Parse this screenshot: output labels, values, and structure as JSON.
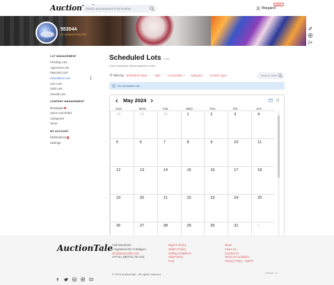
{
  "header": {
    "logo": "AuctionTale",
    "search_placeholder": "Search any keyword or lot number",
    "user_name": "Margaret",
    "user_badge": "admin"
  },
  "profile": {
    "username": "553044",
    "role": "ADMINISTRATOR"
  },
  "sidebar": {
    "sections": [
      {
        "heading": "LOT MANAGEMENT",
        "items": [
          {
            "label": "Pending Lots"
          },
          {
            "label": "Approved Lots"
          },
          {
            "label": "Rejected Lots"
          },
          {
            "label": "Scheduled Lots",
            "active": true
          },
          {
            "label": "Live Lots"
          },
          {
            "label": "Sold Lots"
          },
          {
            "label": "Unsold Lots"
          }
        ]
      },
      {
        "heading": "CONTENT MANAGEMENT",
        "items": [
          {
            "label": "Messages",
            "badge": true
          },
          {
            "label": "Users And Roles"
          },
          {
            "label": "Categories"
          },
          {
            "label": "News"
          }
        ]
      },
      {
        "heading": "MY ACCOUNT",
        "items": [
          {
            "label": "Notifications",
            "badge": true
          },
          {
            "label": "Settings"
          }
        ]
      }
    ]
  },
  "main": {
    "title": "Scheduled Lots",
    "count": "0 lots",
    "subtitle": "Lots scheduled, either planned or live",
    "filter_label": "Filter by:",
    "filters": [
      "Estimated Value",
      "Sale",
      "Lot Number",
      "Category",
      "Auction Type"
    ],
    "search_placeholder": "Search Table",
    "notice": "No scheduled lots"
  },
  "calendar": {
    "month_label": "May 2024",
    "weekdays": [
      "SUN",
      "MON",
      "TUE",
      "WED",
      "THU",
      "FRI",
      "SAT"
    ],
    "weeks": [
      [
        {
          "d": "28",
          "m": true
        },
        {
          "d": "29",
          "m": true
        },
        {
          "d": "30",
          "m": true
        },
        {
          "d": "1"
        },
        {
          "d": "2"
        },
        {
          "d": "3"
        },
        {
          "d": "4"
        }
      ],
      [
        {
          "d": "5"
        },
        {
          "d": "6"
        },
        {
          "d": "7"
        },
        {
          "d": "8"
        },
        {
          "d": "9"
        },
        {
          "d": "10"
        },
        {
          "d": "11"
        }
      ],
      [
        {
          "d": "12"
        },
        {
          "d": "13"
        },
        {
          "d": "14"
        },
        {
          "d": "15"
        },
        {
          "d": "16"
        },
        {
          "d": "17"
        },
        {
          "d": "18"
        }
      ],
      [
        {
          "d": "19"
        },
        {
          "d": "20"
        },
        {
          "d": "21"
        },
        {
          "d": "22"
        },
        {
          "d": "23"
        },
        {
          "d": "24"
        },
        {
          "d": "25"
        }
      ],
      [
        {
          "d": "26"
        },
        {
          "d": "27"
        },
        {
          "d": "28"
        },
        {
          "d": "29"
        },
        {
          "d": "30"
        },
        {
          "d": "31"
        },
        {
          "d": "1",
          "m": true
        }
      ]
    ]
  },
  "footer": {
    "logo": "AuctionTale",
    "address": [
      "Andromeda BV",
      "A registered BV in Belgium",
      "info@auctiontale.com",
      "VAT No. BE0742.757.103"
    ],
    "address_link_index": 2,
    "links_col1": [
      "Buyer's Policy",
      "Seller's Policy",
      "Selling Guidelines",
      "Value Items",
      "FAQ"
    ],
    "links_col2": [
      "News",
      "About Us",
      "Contact Us",
      "Terms & Conditions",
      "Privacy Policy - GDPR"
    ],
    "copyright": "© 2024 AuctionTale - All rights reserved",
    "version": "Version 1.0",
    "socials": [
      "facebook-icon",
      "twitter-icon",
      "linkedin-icon",
      "instagram-icon",
      "youtube-icon"
    ]
  },
  "colors": {
    "accent": "#e0585a",
    "link": "#3c7bd9",
    "notice_bg": "#d9ebfa"
  }
}
